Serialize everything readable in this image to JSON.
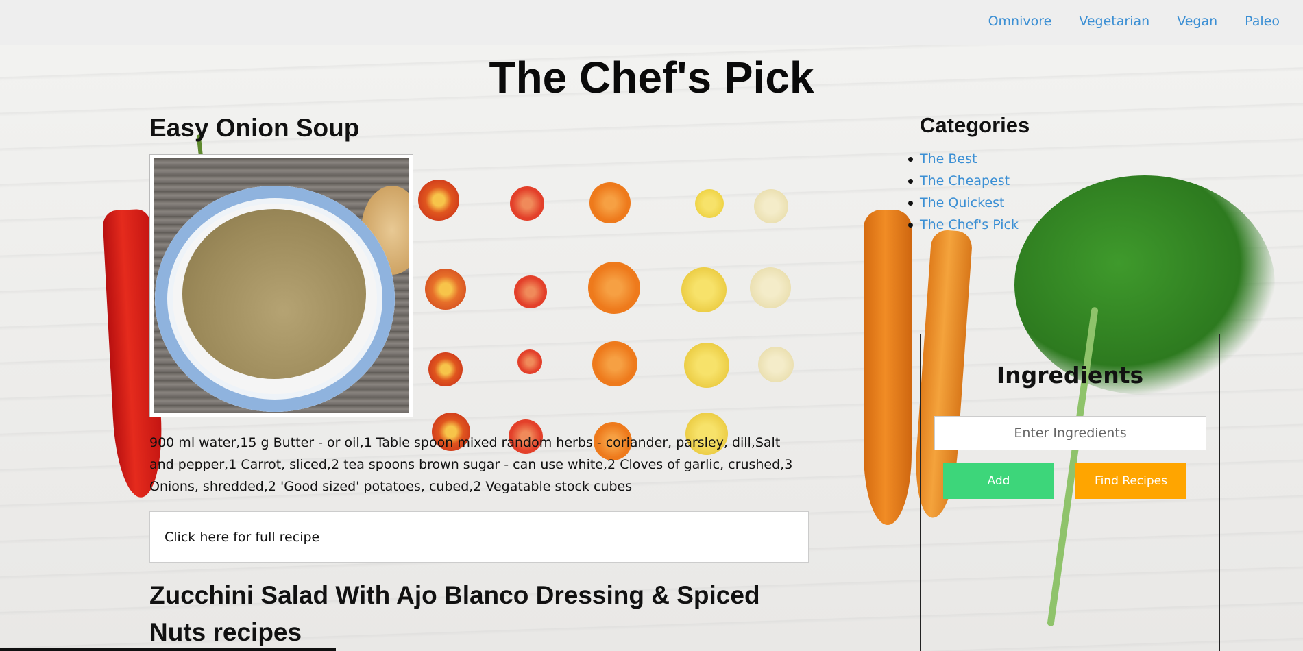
{
  "nav": {
    "items": [
      "Omnivore",
      "Vegetarian",
      "Vegan",
      "Paleo"
    ]
  },
  "site_title": "The Chef's Pick",
  "recipe1": {
    "title": "Easy Onion Soup",
    "ingredients": "900 ml water,15 g Butter - or oil,1 Table spoon mixed random herbs - coriander, parsley, dill,Salt and pepper,1 Carrot, sliced,2 tea spoons brown sugar - can use white,2 Cloves of garlic, crushed,3 Onions, shredded,2 'Good sized' potatoes, cubed,2 Vegatable stock cubes",
    "link_label": "Click here for full recipe"
  },
  "recipe2": {
    "title": "Zucchini Salad With Ajo Blanco Dressing & Spiced Nuts recipes"
  },
  "sidebar": {
    "categories_heading": "Categories",
    "categories": [
      "The Best",
      "The Cheapest",
      "The Quickest",
      "The Chef's Pick"
    ],
    "ingredients_heading": "Ingredients",
    "input_placeholder": "Enter Ingredients",
    "add_label": "Add",
    "find_label": "Find Recipes"
  },
  "colors": {
    "link": "#3b8fd4",
    "add_button": "#3dd67a",
    "find_button": "#ffa500"
  }
}
